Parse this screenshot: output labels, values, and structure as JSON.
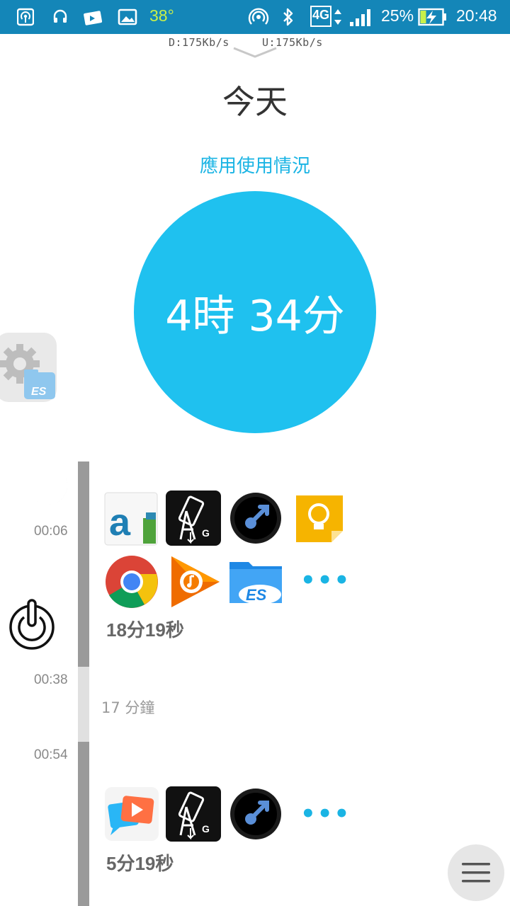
{
  "status_bar": {
    "temperature": "38°",
    "network": "4G",
    "battery": "25%",
    "time": "20:48",
    "icons": [
      "hotspot-icon",
      "headset-icon",
      "photos-icon",
      "gallery-icon",
      "wifi-tethering-icon",
      "bluetooth-icon",
      "signal-icon",
      "battery-charging-icon"
    ]
  },
  "netspeed": {
    "download": "D:175Kb/s",
    "upload": "U:175Kb/s"
  },
  "header": {
    "title": "今天",
    "subtitle": "應用使用情況"
  },
  "summary": {
    "total": "4時 34分"
  },
  "timeline": {
    "times": [
      "00:06",
      "00:38",
      "00:54"
    ],
    "session1": {
      "apps": [
        "amazon-appstore-icon",
        "gravity-app-icon",
        "arrow-app-icon",
        "keep-icon",
        "chrome-icon",
        "play-music-icon",
        "es-file-explorer-icon"
      ],
      "more": "•••",
      "duration": "18分19秒"
    },
    "gap": {
      "label": "17 分鐘"
    },
    "session2": {
      "apps": [
        "video-chat-icon",
        "gravity-app-icon",
        "arrow-app-icon"
      ],
      "more": "•••",
      "duration": "5分19秒"
    }
  },
  "colors": {
    "accent": "#1fc1ef",
    "status_bar": "#1486b8",
    "timeline": "#999999"
  }
}
